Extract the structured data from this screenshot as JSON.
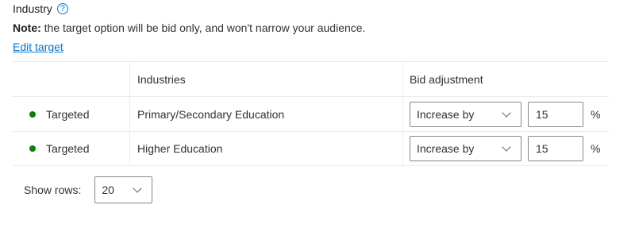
{
  "header": {
    "title": "Industry",
    "help_icon": "question-circle-icon"
  },
  "note": {
    "label": "Note:",
    "text": " the target option will be bid only, and won't narrow your audience."
  },
  "edit_link": "Edit target",
  "table": {
    "columns": [
      "",
      "Industries",
      "Bid adjustment"
    ],
    "rows": [
      {
        "status": "Targeted",
        "status_color": "#107c10",
        "industry": "Primary/Secondary Education",
        "adjustment": "Increase by",
        "value": "15",
        "unit": "%"
      },
      {
        "status": "Targeted",
        "status_color": "#107c10",
        "industry": "Higher Education",
        "adjustment": "Increase by",
        "value": "15",
        "unit": "%"
      }
    ]
  },
  "footer": {
    "show_rows_label": "Show rows:",
    "rows_value": "20"
  },
  "colors": {
    "accent": "#0078d4",
    "targeted": "#107c10"
  }
}
